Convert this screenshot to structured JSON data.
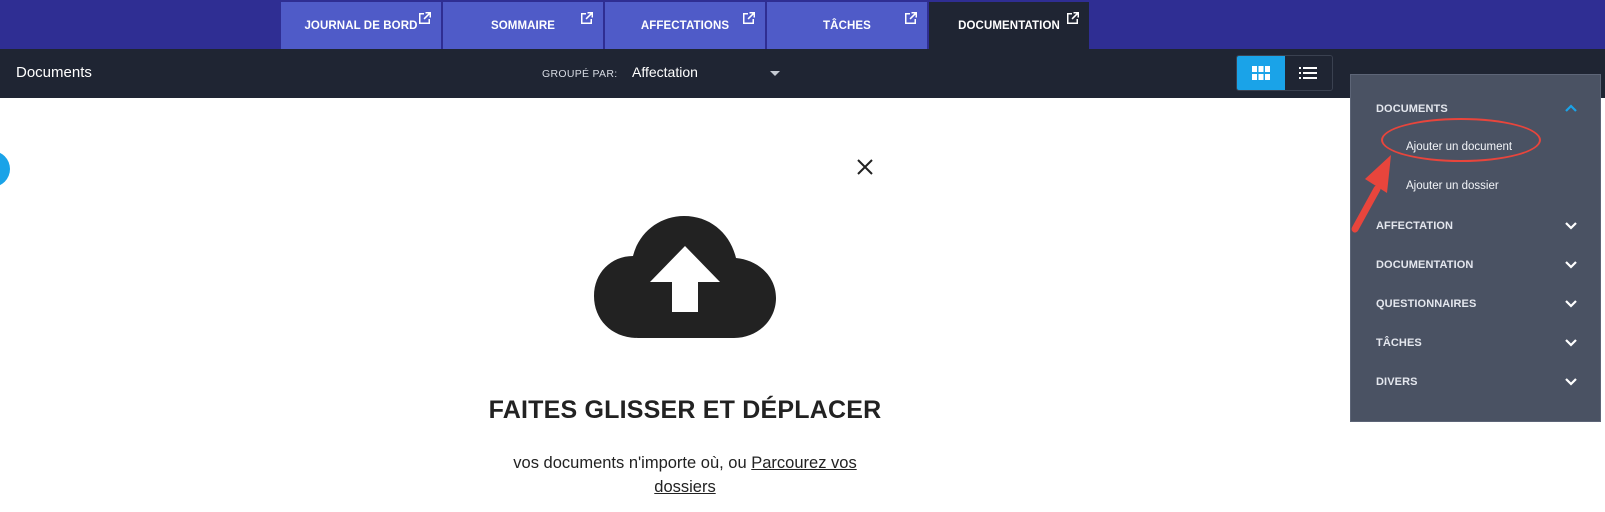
{
  "tabs": [
    {
      "label": "JOURNAL DE BORD",
      "icon": "external-link-icon",
      "active": false
    },
    {
      "label": "SOMMAIRE",
      "icon": "external-link-icon",
      "active": false
    },
    {
      "label": "AFFECTATIONS",
      "icon": "external-link-icon",
      "active": false
    },
    {
      "label": "TÂCHES",
      "icon": "external-link-icon",
      "active": false
    },
    {
      "label": "DOCUMENTATION",
      "icon": "external-link-icon",
      "active": true
    }
  ],
  "toolbar": {
    "title": "Documents",
    "group_label": "GROUPÉ PAR:",
    "group_value": "Affectation",
    "view_modes": [
      "grid-view-icon",
      "list-view-icon"
    ],
    "active_view": "grid"
  },
  "upload": {
    "title": "FAITES GLISSER ET DÉPLACER",
    "subtitle_prefix": "vos documents n'importe où, ou",
    "browse_link": "Parcourez vos dossiers"
  },
  "menu": {
    "sections": [
      {
        "label": "DOCUMENTS",
        "expanded": true,
        "items": [
          "Ajouter un document",
          "Ajouter un dossier"
        ]
      },
      {
        "label": "AFFECTATION",
        "expanded": false
      },
      {
        "label": "DOCUMENTATION",
        "expanded": false
      },
      {
        "label": "QUESTIONNAIRES",
        "expanded": false
      },
      {
        "label": "TÂCHES",
        "expanded": false
      },
      {
        "label": "DIVERS",
        "expanded": false
      }
    ]
  },
  "colors": {
    "topbar": "#2f2e93",
    "tab": "#4f5bc8",
    "toolbar": "#1f2533",
    "accent": "#1aa3e8",
    "menu_bg": "#4a5263",
    "annotation": "#e8453c"
  }
}
